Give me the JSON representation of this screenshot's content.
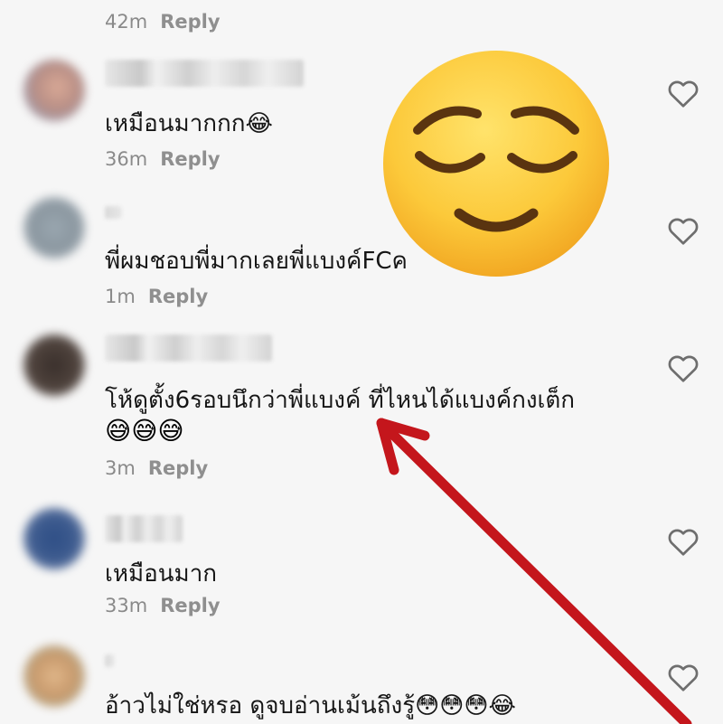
{
  "reply_label": "Reply",
  "top_meta": {
    "time": "42m"
  },
  "comments": [
    {
      "text": "เหมือนมากกก😂",
      "time": "36m"
    },
    {
      "text": "พี่ผมชอบพี่มากเลยพี่แบงค์FCค",
      "time": "1m"
    },
    {
      "text": "โห้ดูตั้ง6รอบนึกว่าพี่แบงค์ ที่ไหนได้แบงค์กงเต็ก",
      "emojis": "😅😅😅",
      "time": "3m"
    },
    {
      "text": "เหมือนมาก",
      "time": "33m"
    },
    {
      "text": "อ้าวไม่ใช่หรอ ดูจบอ่านเม้นถึงรู้😳😳😳😂",
      "time": ""
    }
  ],
  "overlay": {
    "emoji_icon": "relieved-face-icon",
    "arrow_color": "#c4161c"
  },
  "colors": {
    "background": "#f6f6f6",
    "meta_text": "#8a8a8a",
    "heart_outline": "#6e6e6e"
  }
}
